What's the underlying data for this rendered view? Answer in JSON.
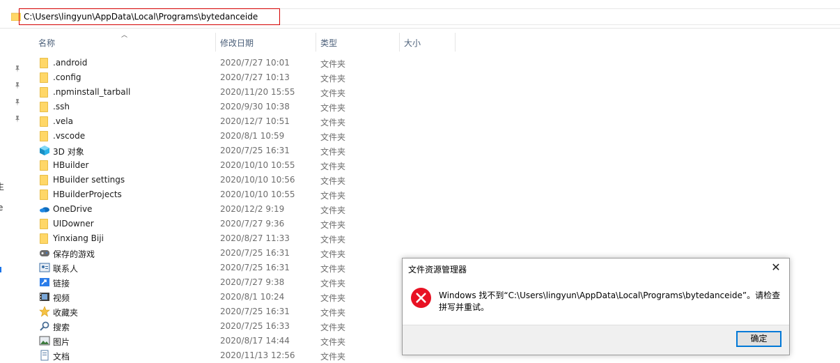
{
  "address_bar": {
    "path": "C:\\Users\\lingyun\\AppData\\Local\\Programs\\bytedanceide"
  },
  "nav_fragments": [
    "生",
    "e"
  ],
  "columns": {
    "name": "名称",
    "date": "修改日期",
    "type": "类型",
    "size": "大小"
  },
  "files": [
    {
      "name": ".android",
      "date": "2020/7/27 10:01",
      "type": "文件夹",
      "icon": "folder-icon"
    },
    {
      "name": ".config",
      "date": "2020/7/27 10:13",
      "type": "文件夹",
      "icon": "folder-icon"
    },
    {
      "name": ".npminstall_tarball",
      "date": "2020/11/20 15:55",
      "type": "文件夹",
      "icon": "folder-icon"
    },
    {
      "name": ".ssh",
      "date": "2020/9/30 10:38",
      "type": "文件夹",
      "icon": "folder-icon"
    },
    {
      "name": ".vela",
      "date": "2020/12/7 10:51",
      "type": "文件夹",
      "icon": "folder-icon"
    },
    {
      "name": ".vscode",
      "date": "2020/8/1 10:59",
      "type": "文件夹",
      "icon": "folder-icon"
    },
    {
      "name": "3D 对象",
      "date": "2020/7/25 16:31",
      "type": "文件夹",
      "icon": "3d-objects-icon"
    },
    {
      "name": "HBuilder",
      "date": "2020/10/10 10:55",
      "type": "文件夹",
      "icon": "folder-icon"
    },
    {
      "name": "HBuilder settings",
      "date": "2020/10/10 10:56",
      "type": "文件夹",
      "icon": "folder-icon"
    },
    {
      "name": "HBuilderProjects",
      "date": "2020/10/10 10:55",
      "type": "文件夹",
      "icon": "folder-icon"
    },
    {
      "name": "OneDrive",
      "date": "2020/12/2 9:19",
      "type": "文件夹",
      "icon": "onedrive-icon"
    },
    {
      "name": "UIDowner",
      "date": "2020/7/27 9:36",
      "type": "文件夹",
      "icon": "folder-icon"
    },
    {
      "name": "Yinxiang Biji",
      "date": "2020/8/27 11:33",
      "type": "文件夹",
      "icon": "folder-icon"
    },
    {
      "name": "保存的游戏",
      "date": "2020/7/25 16:31",
      "type": "文件夹",
      "icon": "saved-games-icon"
    },
    {
      "name": "联系人",
      "date": "2020/7/25 16:31",
      "type": "文件夹",
      "icon": "contacts-icon"
    },
    {
      "name": "链接",
      "date": "2020/7/27 9:38",
      "type": "文件夹",
      "icon": "links-icon"
    },
    {
      "name": "视频",
      "date": "2020/8/1 10:24",
      "type": "文件夹",
      "icon": "videos-icon"
    },
    {
      "name": "收藏夹",
      "date": "2020/7/25 16:31",
      "type": "文件夹",
      "icon": "favorites-icon"
    },
    {
      "name": "搜索",
      "date": "2020/7/25 16:33",
      "type": "文件夹",
      "icon": "searches-icon"
    },
    {
      "name": "图片",
      "date": "2020/8/17 14:44",
      "type": "文件夹",
      "icon": "pictures-icon"
    },
    {
      "name": "文档",
      "date": "2020/11/13 12:56",
      "type": "文件夹",
      "icon": "documents-icon"
    }
  ],
  "dialog": {
    "title": "文件资源管理器",
    "message": "Windows 找不到“C:\\Users\\lingyun\\AppData\\Local\\Programs\\bytedanceide”。请检查拼写并重试。",
    "ok_label": "确定",
    "close_glyph": "✕"
  },
  "colors": {
    "accent": "#0078d7",
    "error": "#e81123",
    "folder": "#ffd767",
    "highlight_border": "#d40000"
  }
}
